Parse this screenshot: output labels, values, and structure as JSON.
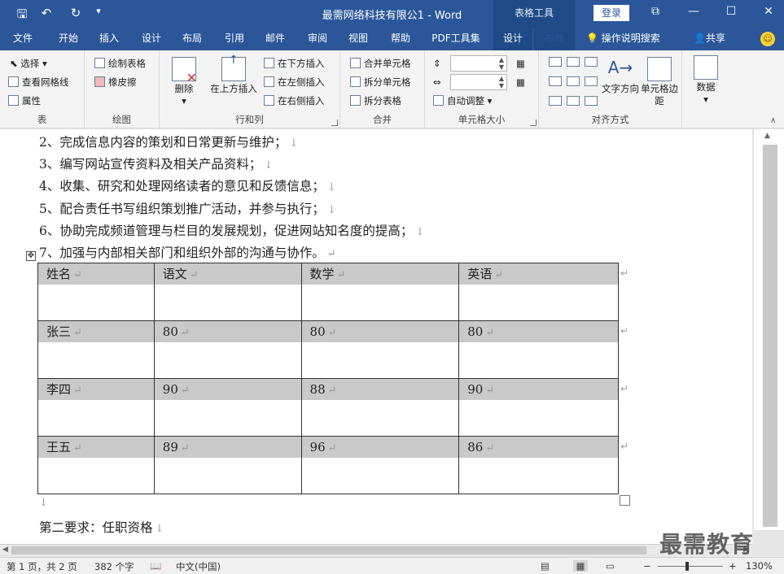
{
  "window": {
    "title": "最需网络科技有限公1 - Word",
    "table_tools_label": "表格工具",
    "login_label": "登录",
    "restore_glyph": "⧉",
    "minimize_glyph": "—",
    "maximize_glyph": "☐",
    "close_glyph": "✕"
  },
  "quick_access": {
    "save_glyph": "🖫",
    "undo_glyph": "↶",
    "redo_glyph": "↻",
    "customize_glyph": "▾"
  },
  "tabs": [
    "文件",
    "开始",
    "插入",
    "设计",
    "布局",
    "引用",
    "邮件",
    "审阅",
    "视图",
    "帮助",
    "PDF工具集",
    "设计",
    "布局"
  ],
  "tell_me": "操作说明搜索",
  "share": "共享",
  "ribbon": {
    "table_group": {
      "label": "表",
      "select": "选择",
      "view_gridlines": "查看网格线",
      "properties": "属性"
    },
    "draw_group": {
      "label": "绘图",
      "draw_table": "绘制表格",
      "eraser": "橡皮擦"
    },
    "rows_cols_group": {
      "label": "行和列",
      "delete": "删除",
      "insert_above": "在上方插入",
      "insert_below": "在下方插入",
      "insert_left": "在左侧插入",
      "insert_right": "在右侧插入"
    },
    "merge_group": {
      "label": "合并",
      "merge_cells": "合并单元格",
      "split_cells": "拆分单元格",
      "split_table": "拆分表格"
    },
    "cell_size_group": {
      "label": "单元格大小",
      "autofit": "自动调整"
    },
    "align_group": {
      "label": "对齐方式",
      "text_direction": "文字方向",
      "cell_margins": "单元格边距"
    },
    "data_group": {
      "label": "数据",
      "data": "数据"
    }
  },
  "document": {
    "lines": [
      "2、完成信息内容的策划和日常更新与维护；",
      "3、编写网站宣传资料及相关产品资料；",
      "4、收集、研究和处理网络读者的意见和反馈信息；",
      "5、配合责任书写组织策划推广活动，并参与执行；",
      "6、协助完成频道管理与栏目的发展规划，促进网站知名度的提高；",
      "7、加强与内部相关部门和组织外部的沟通与协作。"
    ],
    "line_marks": [
      "↓",
      "↓",
      "↓",
      "↓",
      "↓",
      "↵"
    ],
    "table": {
      "headers": [
        "姓名",
        "语文",
        "数学",
        "英语"
      ],
      "rows": [
        [
          "张三",
          "80",
          "80",
          "80"
        ],
        [
          "李四",
          "90",
          "88",
          "90"
        ],
        [
          "王五",
          "89",
          "96",
          "86"
        ]
      ]
    },
    "cell_mark": "↵",
    "after_table_mark": "↓",
    "next_heading": "第二要求：任职资格",
    "next_heading_mark": "↓"
  },
  "status": {
    "page": "第 1 页，共 2 页",
    "words": "382 个字",
    "language": "中文(中国)",
    "zoom": "130%",
    "zoom_minus": "−",
    "zoom_plus": "+"
  },
  "watermark": "最需教育"
}
